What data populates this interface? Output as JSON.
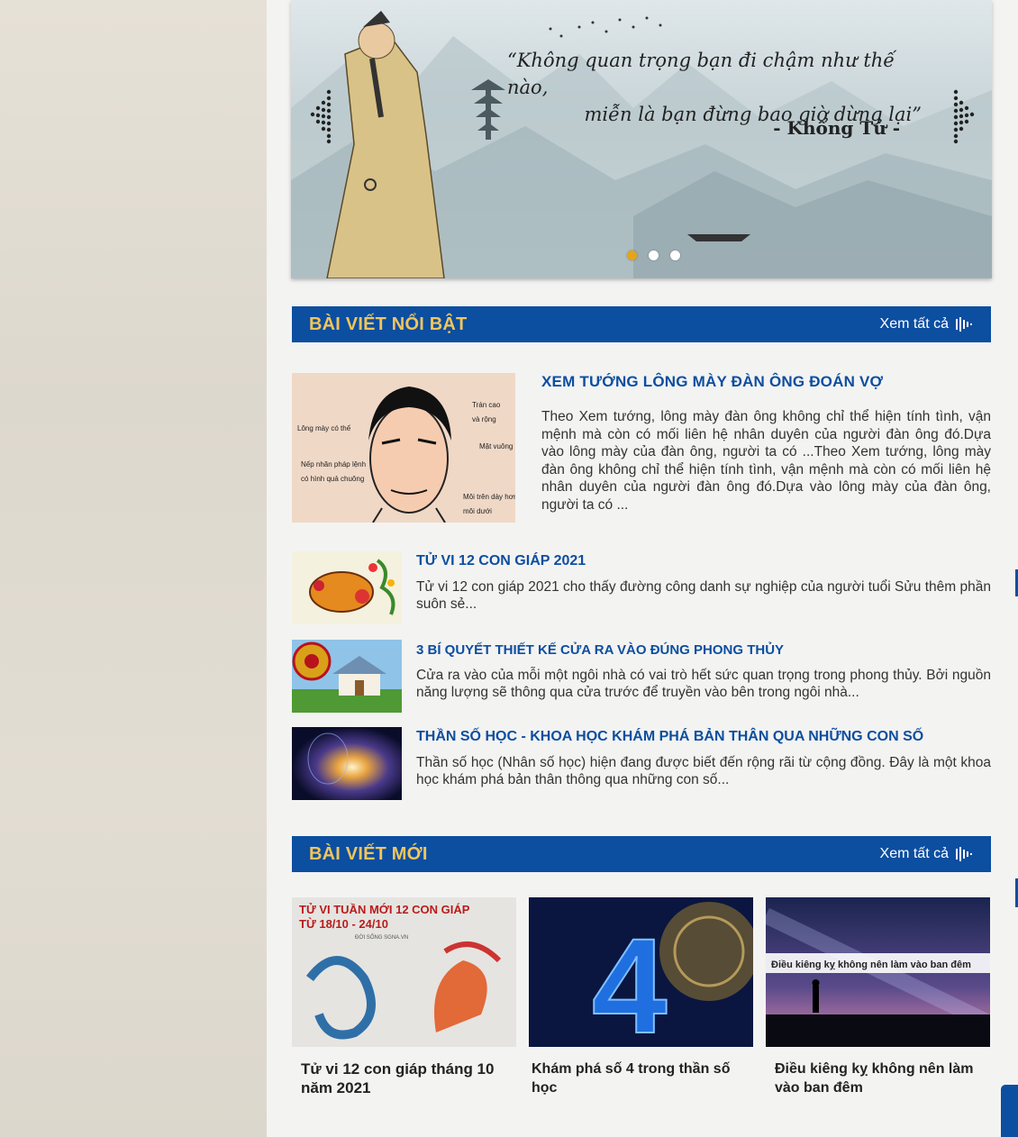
{
  "banner": {
    "quote_line1": "“Không quan trọng bạn đi chậm như thế nào,",
    "quote_line2": "miễn là bạn đừng bao giờ dừng lại”",
    "author": "- Khổng Tử -",
    "slide_count": 3,
    "active_slide": 1
  },
  "featured": {
    "header": "BÀI VIẾT NỔI BẬT",
    "see_all": "Xem tất cả",
    "main": {
      "title": "XEM TƯỚNG LÔNG MÀY ĐÀN ÔNG ĐOÁN VỢ",
      "desc": "Theo Xem tướng, lông mày đàn ông không chỉ thể hiện tính tình, vận mệnh mà còn có mối liên hệ nhân duyên của người đàn ông đó.Dựa vào lông mày của đàn ông, người ta có ...Theo Xem tướng, lông mày đàn ông không chỉ thể hiện tính tình, vận mệnh mà còn có mối liên hệ nhân duyên của người đàn ông đó.Dựa vào lông mày của đàn ông, người ta có ...",
      "image_labels": {
        "tran": "Trán cao",
        "tran2": "và rộng",
        "long_may": "Lông mày có thế",
        "mat": "Mặt vuông",
        "nep": "Nếp nhăn pháp lệnh",
        "nep2": "có hình quả chuông",
        "moi": "Môi trên dày hơn",
        "moi2": "môi dưới"
      }
    },
    "items": [
      {
        "title": "TỬ VI 12 CON GIÁP 2021",
        "desc": "Tử vi 12 con giáp 2021 cho thấy đường công danh sự nghiệp của người tuổi Sửu thêm phần suôn sẻ..."
      },
      {
        "title": "3 BÍ QUYẾT THIẾT KẾ CỬA RA VÀO ĐÚNG PHONG THỦY",
        "desc": "Cửa ra vào của mỗi một ngôi nhà có vai trò hết sức quan trọng trong phong thủy. Bởi nguồn năng lượng sẽ thông qua cửa trước để truyền vào bên trong ngôi nhà..."
      },
      {
        "title": "THẦN SỐ HỌC - KHOA HỌC KHÁM PHÁ BẢN THÂN QUA NHỮNG CON SỐ",
        "desc": "Thần số học (Nhân số học) hiện đang được biết đến rộng rãi từ cộng đồng. Đây là một khoa học khám phá bản thân thông qua những con số..."
      }
    ]
  },
  "latest": {
    "header": "BÀI VIẾT MỚI",
    "see_all": "Xem tất cả",
    "cards": [
      {
        "title": "Tử vi 12 con giáp tháng 10 năm 2021",
        "img_text1": "TỬ VI TUẦN MỚI 12 CON GIÁP",
        "img_text2": "TỪ 18/10 - 24/10",
        "img_text3": "ĐỜI SỐNG SGNA.VN"
      },
      {
        "title": "Khám phá số 4 trong thần số học",
        "img_text1": "4"
      },
      {
        "title": "Điều kiêng kỵ không nên làm vào ban đêm",
        "img_text1": "Điều kiêng kỵ không nên làm vào ban đêm"
      }
    ]
  },
  "colors": {
    "accent_blue": "#0c4ea0",
    "header_gold": "#f1c55b",
    "dot_active": "#e4a51a"
  }
}
